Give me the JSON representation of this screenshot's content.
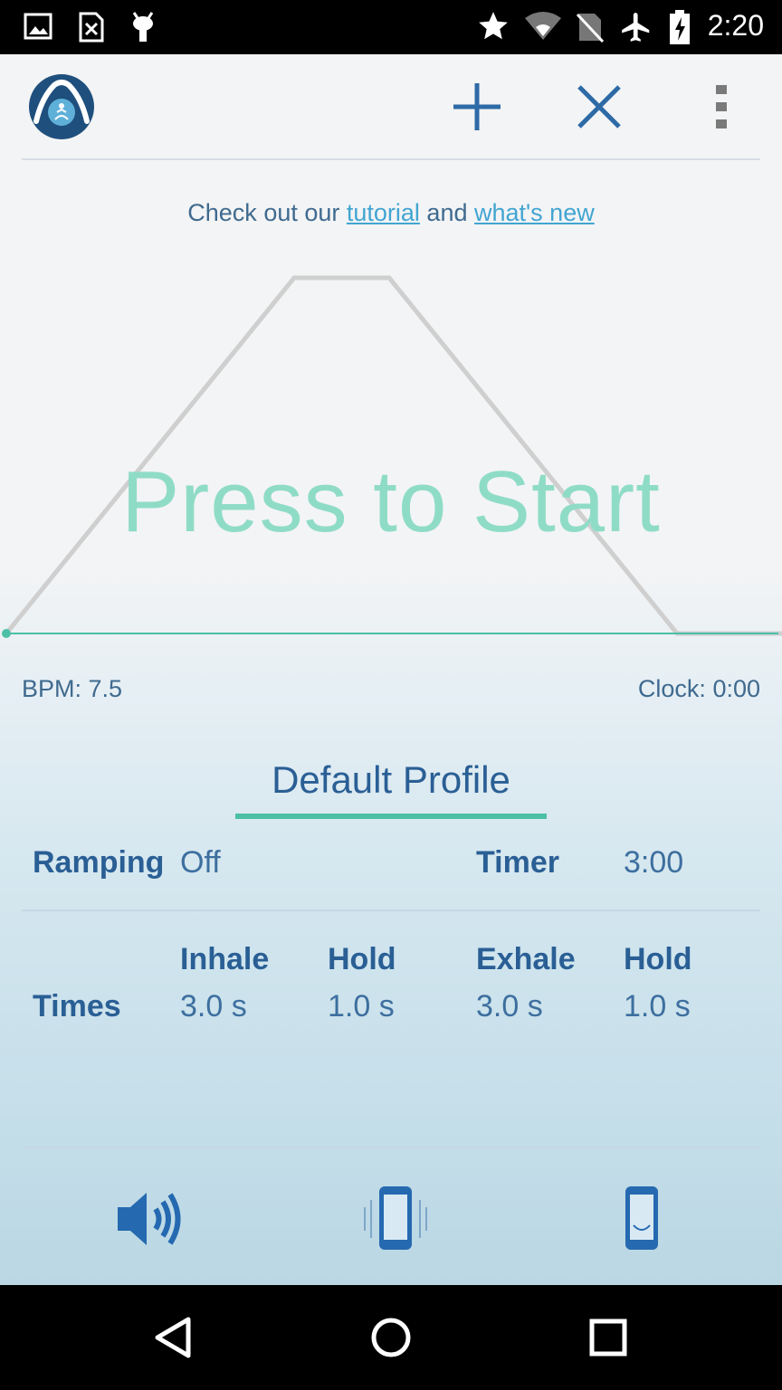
{
  "status_bar": {
    "time": "2:20",
    "left_icons": [
      "image-icon",
      "sim-card-x-icon",
      "android-icon"
    ],
    "right_icons": [
      "star-icon",
      "wifi-icon",
      "no-sim-icon",
      "airplane-icon",
      "battery-charging-icon"
    ]
  },
  "toolbar": {
    "logo_icon": "meditation-logo-icon",
    "add_icon": "plus-icon",
    "close_icon": "close-icon",
    "menu_icon": "more-vert-icon"
  },
  "intro": {
    "prefix": "Check out our ",
    "tutorial_link": "tutorial",
    "middle": " and ",
    "whats_new_link": "what's new"
  },
  "graph": {
    "start_label": "Press to Start"
  },
  "stats": {
    "bpm": "BPM: 7.5",
    "clock": "Clock: 0:00"
  },
  "profile": {
    "title": "Default Profile",
    "ramping_label": "Ramping",
    "ramping_value": "Off",
    "timer_label": "Timer",
    "timer_value": "3:00",
    "times_label": "Times",
    "phases": [
      {
        "label": "Inhale",
        "value": "3.0 s"
      },
      {
        "label": "Hold",
        "value": "1.0 s"
      },
      {
        "label": "Exhale",
        "value": "3.0 s"
      },
      {
        "label": "Hold",
        "value": "1.0 s"
      }
    ]
  },
  "bottom_controls": {
    "sound_icon": "volume-icon",
    "vibrate_icon": "vibrate-icon",
    "phone_icon": "phone-screen-icon"
  },
  "nav": {
    "back_icon": "back-icon",
    "home_icon": "home-icon",
    "recents_icon": "recents-icon"
  },
  "colors": {
    "accent": "#4cc0a6",
    "primary_text": "#2a5f95",
    "link": "#42a5d2",
    "press_to_start": "#8fdcc6"
  }
}
